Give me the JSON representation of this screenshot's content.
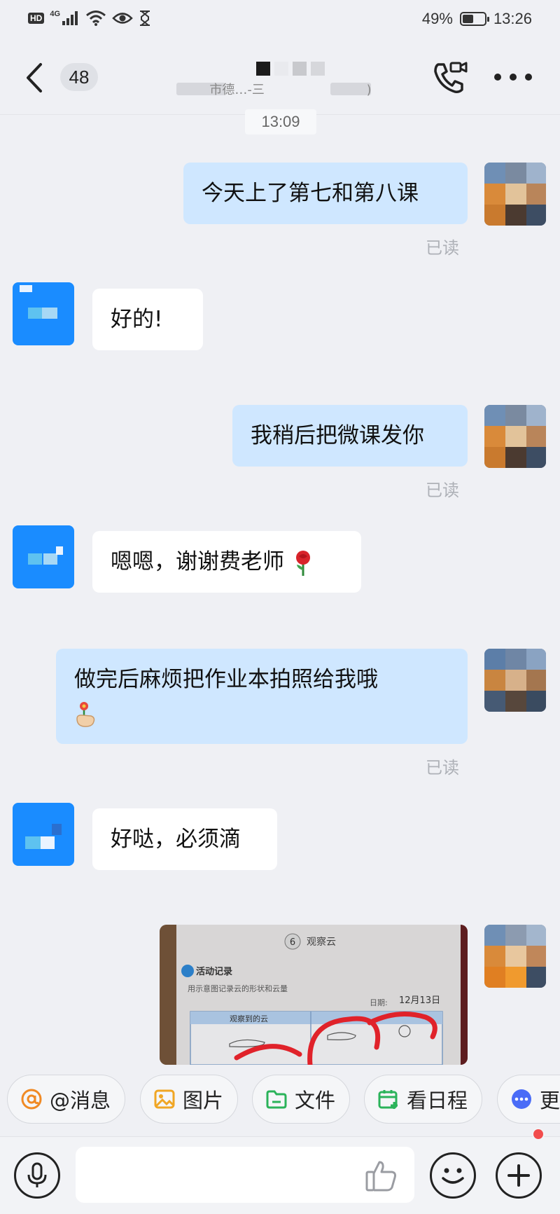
{
  "status_bar": {
    "hd_label": "HD",
    "network_label": "4G",
    "battery_text": "49%",
    "battery_level": 0.49,
    "time": "13:26"
  },
  "header": {
    "unread_count": "48",
    "subtitle_visible": "市德…-三",
    "subtitle_tail": ")"
  },
  "chat": {
    "time_divider": "13:09",
    "messages": [
      {
        "direction": "out",
        "text": "今天上了第七和第八课",
        "receipt": "已读"
      },
      {
        "direction": "in",
        "text": "好的!"
      },
      {
        "direction": "out",
        "text": "我稍后把微课发你",
        "receipt": "已读"
      },
      {
        "direction": "in",
        "text": "嗯嗯，谢谢费老师",
        "emoji": "rose-emoji"
      },
      {
        "direction": "out",
        "text": "做完后麻烦把作业本拍照给我哦",
        "emoji": "hand-holding-flower-emoji",
        "receipt": "已读"
      },
      {
        "direction": "in",
        "text": "好哒，必须滴"
      },
      {
        "direction": "out",
        "type": "image",
        "image_text": {
          "lesson_number": "6",
          "lesson_title": "观察云",
          "section": "活动记录",
          "instruction": "用示意图记录云的形状和云量",
          "date_label": "日期:",
          "date_value": "12月13日",
          "column_header": "观察到的云"
        }
      }
    ]
  },
  "quick_actions": [
    {
      "label": "@消息",
      "icon": "at-icon",
      "color": "#f08a24"
    },
    {
      "label": "图片",
      "icon": "image-icon",
      "color": "#f0a624"
    },
    {
      "label": "文件",
      "icon": "folder-icon",
      "color": "#2bb35a"
    },
    {
      "label": "看日程",
      "icon": "calendar-icon",
      "color": "#2bb35a"
    },
    {
      "label": "更",
      "icon": "more-circle-icon",
      "color": "#4a6cf7"
    }
  ],
  "input_bar": {
    "placeholder": ""
  },
  "colors": {
    "background": "#eff0f4",
    "outgoing_bubble": "#cfe7ff",
    "incoming_bubble": "#ffffff",
    "peer_avatar": "#1a8cff",
    "notification_dot": "#f24c4c"
  }
}
